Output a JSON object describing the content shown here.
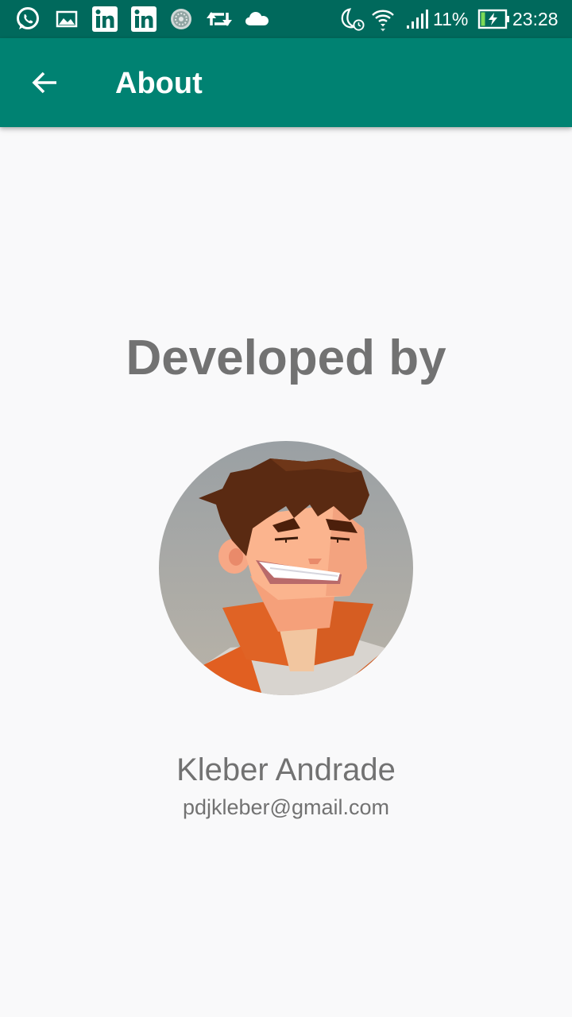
{
  "status_bar": {
    "left_icons": [
      "whatsapp-icon",
      "image-icon",
      "linkedin-icon",
      "linkedin-icon",
      "app-icon",
      "retweet-icon",
      "cloud-icon"
    ],
    "right_icons": [
      "do-not-disturb-alarm-icon",
      "wifi-icon",
      "signal-icon",
      "battery-charging-icon"
    ],
    "battery": "11%",
    "time": "23:28"
  },
  "app_bar": {
    "title": "About",
    "back_icon": "arrow-back-icon"
  },
  "content": {
    "heading": "Developed by",
    "avatar": "avatar-cartoon-portrait",
    "name": "Kleber Andrade",
    "email": "pdjkleber@gmail.com"
  },
  "colors": {
    "status_bar": "#00695c",
    "app_bar": "#008272",
    "background": "#f9f9fa",
    "text": "#727272"
  }
}
